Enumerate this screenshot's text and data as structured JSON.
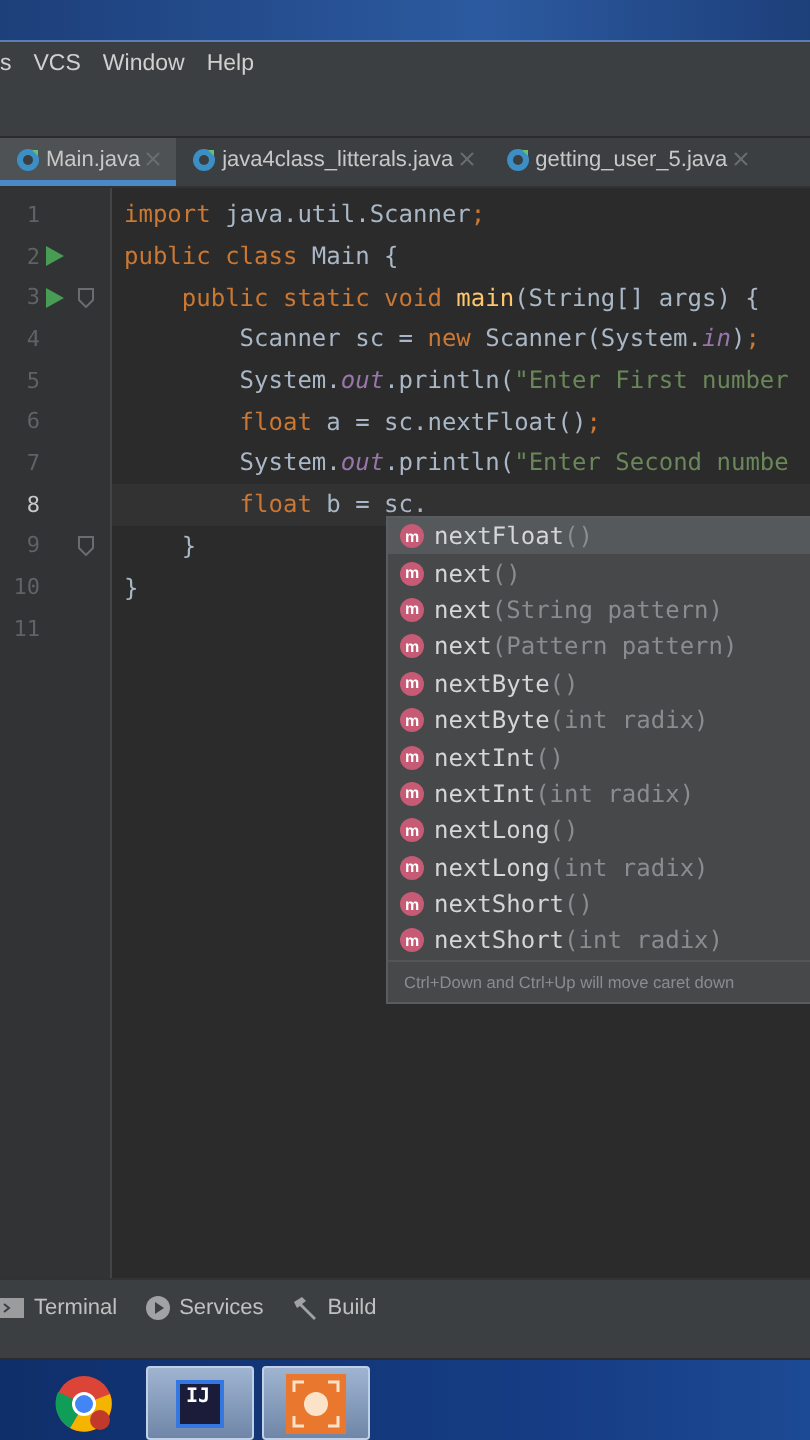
{
  "menu": [
    "s",
    "VCS",
    "Window",
    "Help"
  ],
  "tabs": [
    {
      "label": "Main.java",
      "selected": true
    },
    {
      "label": "java4class_litterals.java",
      "selected": false
    },
    {
      "label": "getting_user_5.java",
      "selected": false
    }
  ],
  "code": [
    {
      "number": "1",
      "current": false,
      "tokens": [
        {
          "kind": "kw",
          "text": "import "
        },
        {
          "kind": "plain",
          "text": "java.util.Scanner"
        },
        {
          "kind": "kw",
          "text": ";"
        }
      ]
    },
    {
      "number": "2",
      "current": false,
      "gutter_icons": [
        {
          "kind": "run"
        }
      ],
      "tokens": [
        {
          "kind": "kw",
          "text": "public class "
        },
        {
          "kind": "plain",
          "text": "Main {"
        }
      ]
    },
    {
      "number": "3",
      "current": false,
      "gutter_icons": [
        {
          "kind": "run"
        },
        {
          "kind": "fold"
        }
      ],
      "tokens": [
        {
          "kind": "kw",
          "text": "    public static void "
        },
        {
          "kind": "method",
          "text": "main"
        },
        {
          "kind": "plain",
          "text": "(String[] args) {"
        }
      ]
    },
    {
      "number": "4",
      "current": false,
      "tokens": [
        {
          "kind": "plain",
          "text": "        Scanner sc = "
        },
        {
          "kind": "kw",
          "text": "new "
        },
        {
          "kind": "plain",
          "text": "Scanner(System."
        },
        {
          "kind": "field",
          "text": "in"
        },
        {
          "kind": "plain",
          "text": ")"
        },
        {
          "kind": "kw",
          "text": ";"
        }
      ]
    },
    {
      "number": "5",
      "current": false,
      "tokens": [
        {
          "kind": "plain",
          "text": "        System."
        },
        {
          "kind": "field",
          "text": "out"
        },
        {
          "kind": "plain",
          "text": ".println("
        },
        {
          "kind": "str",
          "text": "\"Enter First number"
        }
      ]
    },
    {
      "number": "6",
      "current": false,
      "tokens": [
        {
          "kind": "kw",
          "text": "        float "
        },
        {
          "kind": "plain",
          "text": "a = sc.nextFloat()"
        },
        {
          "kind": "kw",
          "text": ";"
        }
      ]
    },
    {
      "number": "7",
      "current": false,
      "tokens": [
        {
          "kind": "plain",
          "text": "        System."
        },
        {
          "kind": "field",
          "text": "out"
        },
        {
          "kind": "plain",
          "text": ".println("
        },
        {
          "kind": "str",
          "text": "\"Enter Second numbe"
        }
      ]
    },
    {
      "number": "8",
      "current": true,
      "tokens": [
        {
          "kind": "kw",
          "text": "        float "
        },
        {
          "kind": "plain",
          "text": "b = sc."
        }
      ]
    },
    {
      "number": "9",
      "current": false,
      "gutter_icons": [
        {
          "kind": "fold"
        }
      ],
      "tokens": [
        {
          "kind": "plain",
          "text": "    }"
        }
      ]
    },
    {
      "number": "10",
      "current": false,
      "tokens": [
        {
          "kind": "plain",
          "text": "}"
        }
      ]
    },
    {
      "number": "11",
      "current": false
    }
  ],
  "completion": {
    "items": [
      {
        "badge": "m",
        "name": "nextFloat",
        "params": "()",
        "selected": true
      },
      {
        "badge": "m",
        "name": "next",
        "params": "()",
        "selected": false
      },
      {
        "badge": "m",
        "name": "next",
        "params": "(String pattern)",
        "selected": false
      },
      {
        "badge": "m",
        "name": "next",
        "params": "(Pattern pattern)",
        "selected": false
      },
      {
        "badge": "m",
        "name": "nextByte",
        "params": "()",
        "selected": false
      },
      {
        "badge": "m",
        "name": "nextByte",
        "params": "(int radix)",
        "selected": false
      },
      {
        "badge": "m",
        "name": "nextInt",
        "params": "()",
        "selected": false
      },
      {
        "badge": "m",
        "name": "nextInt",
        "params": "(int radix)",
        "selected": false
      },
      {
        "badge": "m",
        "name": "nextLong",
        "params": "()",
        "selected": false
      },
      {
        "badge": "m",
        "name": "nextLong",
        "params": "(int radix)",
        "selected": false
      },
      {
        "badge": "m",
        "name": "nextShort",
        "params": "()",
        "selected": false
      },
      {
        "badge": "m",
        "name": "nextShort",
        "params": "(int radix)",
        "selected": false
      }
    ],
    "hint": "Ctrl+Down and Ctrl+Up will move caret down"
  },
  "tool_windows": [
    {
      "kind": "terminal",
      "label": "Terminal"
    },
    {
      "kind": "services",
      "label": "Services"
    },
    {
      "kind": "build",
      "label": "Build"
    }
  ],
  "taskbar": [
    {
      "kind": "browser",
      "selected": false
    },
    {
      "kind": "ide",
      "label": "IJ",
      "selected": true
    },
    {
      "kind": "recorder",
      "selected": true
    }
  ]
}
